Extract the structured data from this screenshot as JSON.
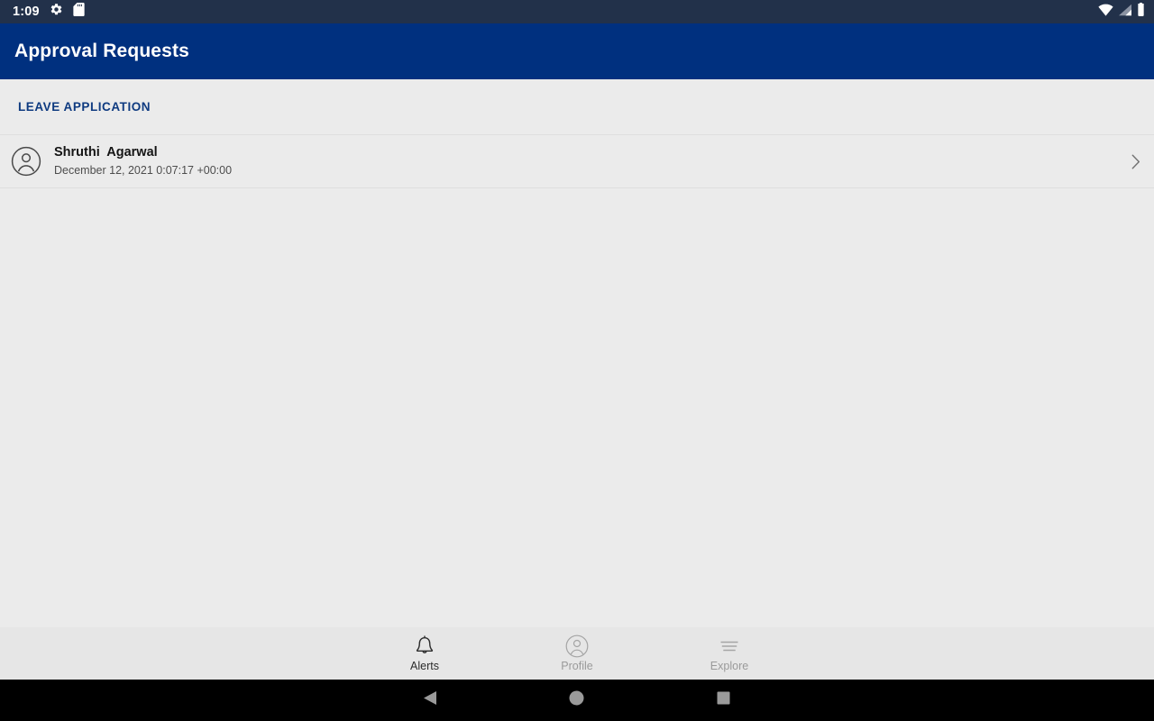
{
  "status_bar": {
    "clock": "1:09",
    "left_icons": [
      {
        "name": "settings-gear-icon"
      },
      {
        "name": "sd-card-icon"
      }
    ],
    "right_icons": [
      {
        "name": "wifi-icon"
      },
      {
        "name": "cellular-signal-icon"
      },
      {
        "name": "battery-icon"
      }
    ],
    "background": "#22314a",
    "foreground": "#ffffff"
  },
  "app_bar": {
    "title": "Approval Requests",
    "background": "#00307f",
    "title_color": "#ffffff"
  },
  "main": {
    "background": "#ebebeb",
    "sections": [
      {
        "header": "LEAVE APPLICATION",
        "header_color": "#0e3a80",
        "items": [
          {
            "avatar_icon": "account-circle-icon",
            "title": "Shruthi  Agarwal",
            "subtitle": "December 12, 2021 0:07:17 +00:00",
            "chevron_icon": "chevron-right-icon"
          }
        ]
      }
    ]
  },
  "bottom_nav": {
    "background": "#e6e6e6",
    "active_color": "#2b2b2b",
    "inactive_color": "#9a9a9a",
    "items": [
      {
        "label": "Alerts",
        "icon": "bell-icon",
        "active": true
      },
      {
        "label": "Profile",
        "icon": "account-circle-icon",
        "active": false
      },
      {
        "label": "Explore",
        "icon": "menu-lines-icon",
        "active": false
      }
    ]
  },
  "system_nav": {
    "background": "#000000",
    "buttons": [
      {
        "name": "back-button",
        "icon": "triangle-left-icon"
      },
      {
        "name": "home-button",
        "icon": "circle-icon"
      },
      {
        "name": "recents-button",
        "icon": "square-icon"
      }
    ]
  }
}
